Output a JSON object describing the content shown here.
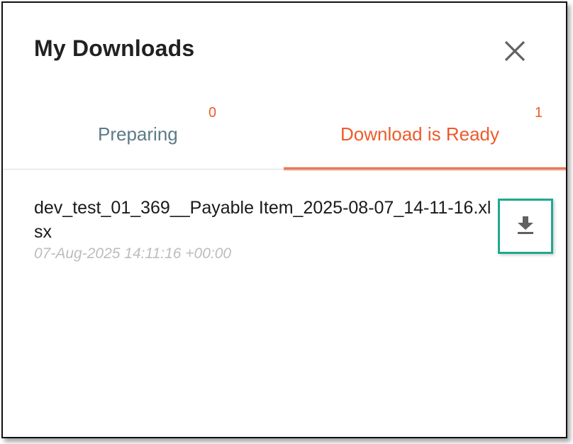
{
  "dialog": {
    "title": "My Downloads",
    "close_icon": "close-icon"
  },
  "tabs": [
    {
      "label": "Preparing",
      "count": "0",
      "active": false
    },
    {
      "label": "Download is Ready",
      "count": "1",
      "active": true
    }
  ],
  "downloads": [
    {
      "file_name": "dev_test_01_369__Payable Item_2025-08-07_14-11-16.xlsx",
      "timestamp": "07-Aug-2025 14:11:16 +00:00",
      "action_icon": "download-icon"
    }
  ],
  "colors": {
    "accent": "#ef5a2a",
    "inactive_tab": "#5e7a87",
    "highlight_border": "#1fa88f",
    "timestamp": "#bdbdbd"
  }
}
